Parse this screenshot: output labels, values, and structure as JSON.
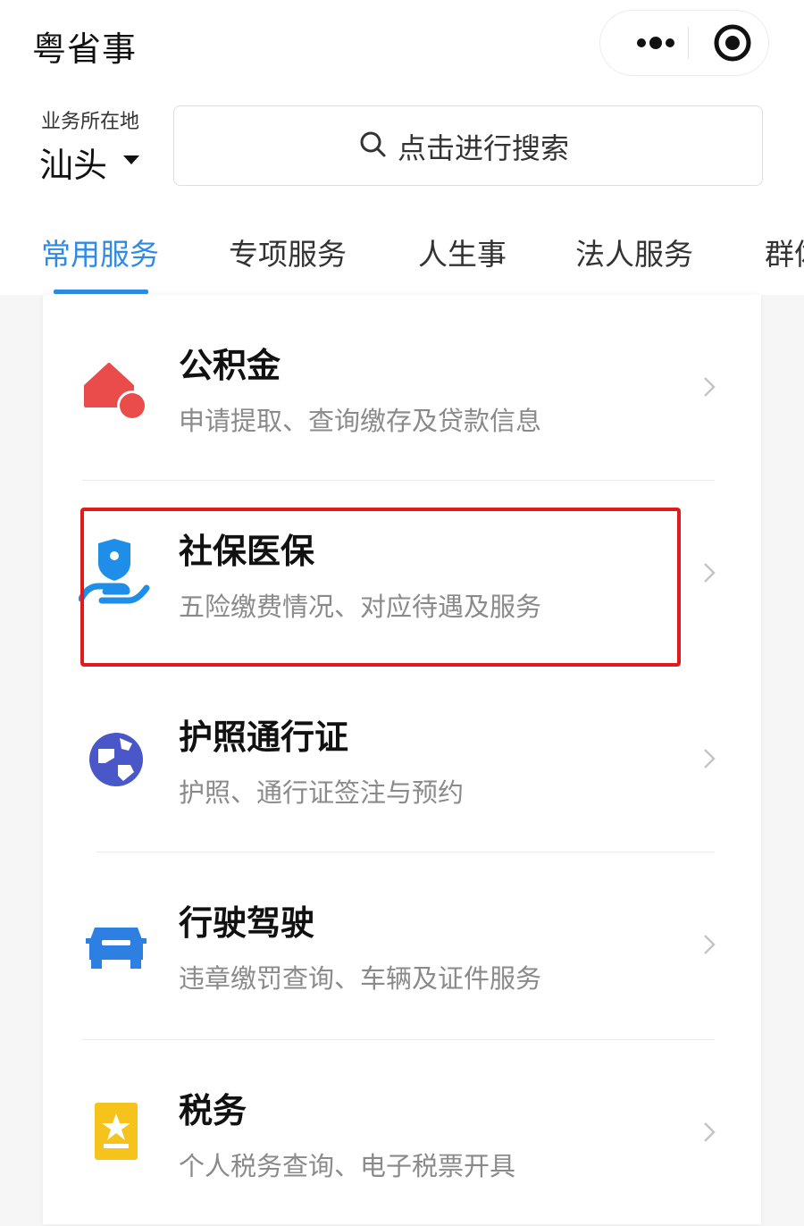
{
  "header": {
    "title": "粤省事"
  },
  "location": {
    "label": "业务所在地",
    "city": "汕头"
  },
  "search": {
    "placeholder": "点击进行搜索"
  },
  "tabs": [
    {
      "label": "常用服务",
      "active": true
    },
    {
      "label": "专项服务",
      "active": false
    },
    {
      "label": "人生事",
      "active": false
    },
    {
      "label": "法人服务",
      "active": false
    },
    {
      "label": "群体",
      "active": false
    }
  ],
  "services": [
    {
      "title": "公积金",
      "desc": "申请提取、查询缴存及贷款信息",
      "icon": "house-coin-icon"
    },
    {
      "title": "社保医保",
      "desc": "五险缴费情况、对应待遇及服务",
      "icon": "shield-hand-icon",
      "highlighted": true
    },
    {
      "title": "护照通行证",
      "desc": "护照、通行证签注与预约",
      "icon": "globe-icon"
    },
    {
      "title": "行驶驾驶",
      "desc": "违章缴罚查询、车辆及证件服务",
      "icon": "car-icon"
    },
    {
      "title": "税务",
      "desc": "个人税务查询、电子税票开具",
      "icon": "star-ticket-icon"
    }
  ],
  "colors": {
    "accent": "#2f8ae5",
    "highlight_border": "#e11b1b",
    "gjj_icon": "#ea4b4b",
    "shebao_icon": "#1f8ee8",
    "passport_icon": "#4a57c8",
    "car_icon": "#2d7fe2",
    "tax_icon": "#f6c21c"
  }
}
